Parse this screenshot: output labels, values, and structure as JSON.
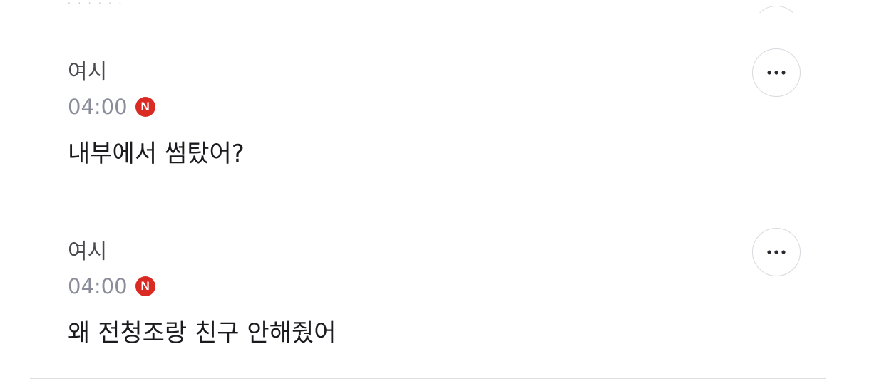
{
  "top_partial": {
    "text": "· · · · · ·"
  },
  "comments": [
    {
      "author": "여시",
      "time": "04:00",
      "badge": "N",
      "text": "내부에서 썸탔어?"
    },
    {
      "author": "여시",
      "time": "04:00",
      "badge": "N",
      "text": "왜 전청조랑 친구 안해줬어"
    }
  ],
  "colors": {
    "badge": "#d92b23",
    "time": "#8a8d99",
    "author": "#4a4a50",
    "text": "#1b1b1f",
    "divider": "#dedee2"
  },
  "icons": {
    "more": "more-horizontal-icon",
    "new_badge": "new-badge-icon"
  }
}
